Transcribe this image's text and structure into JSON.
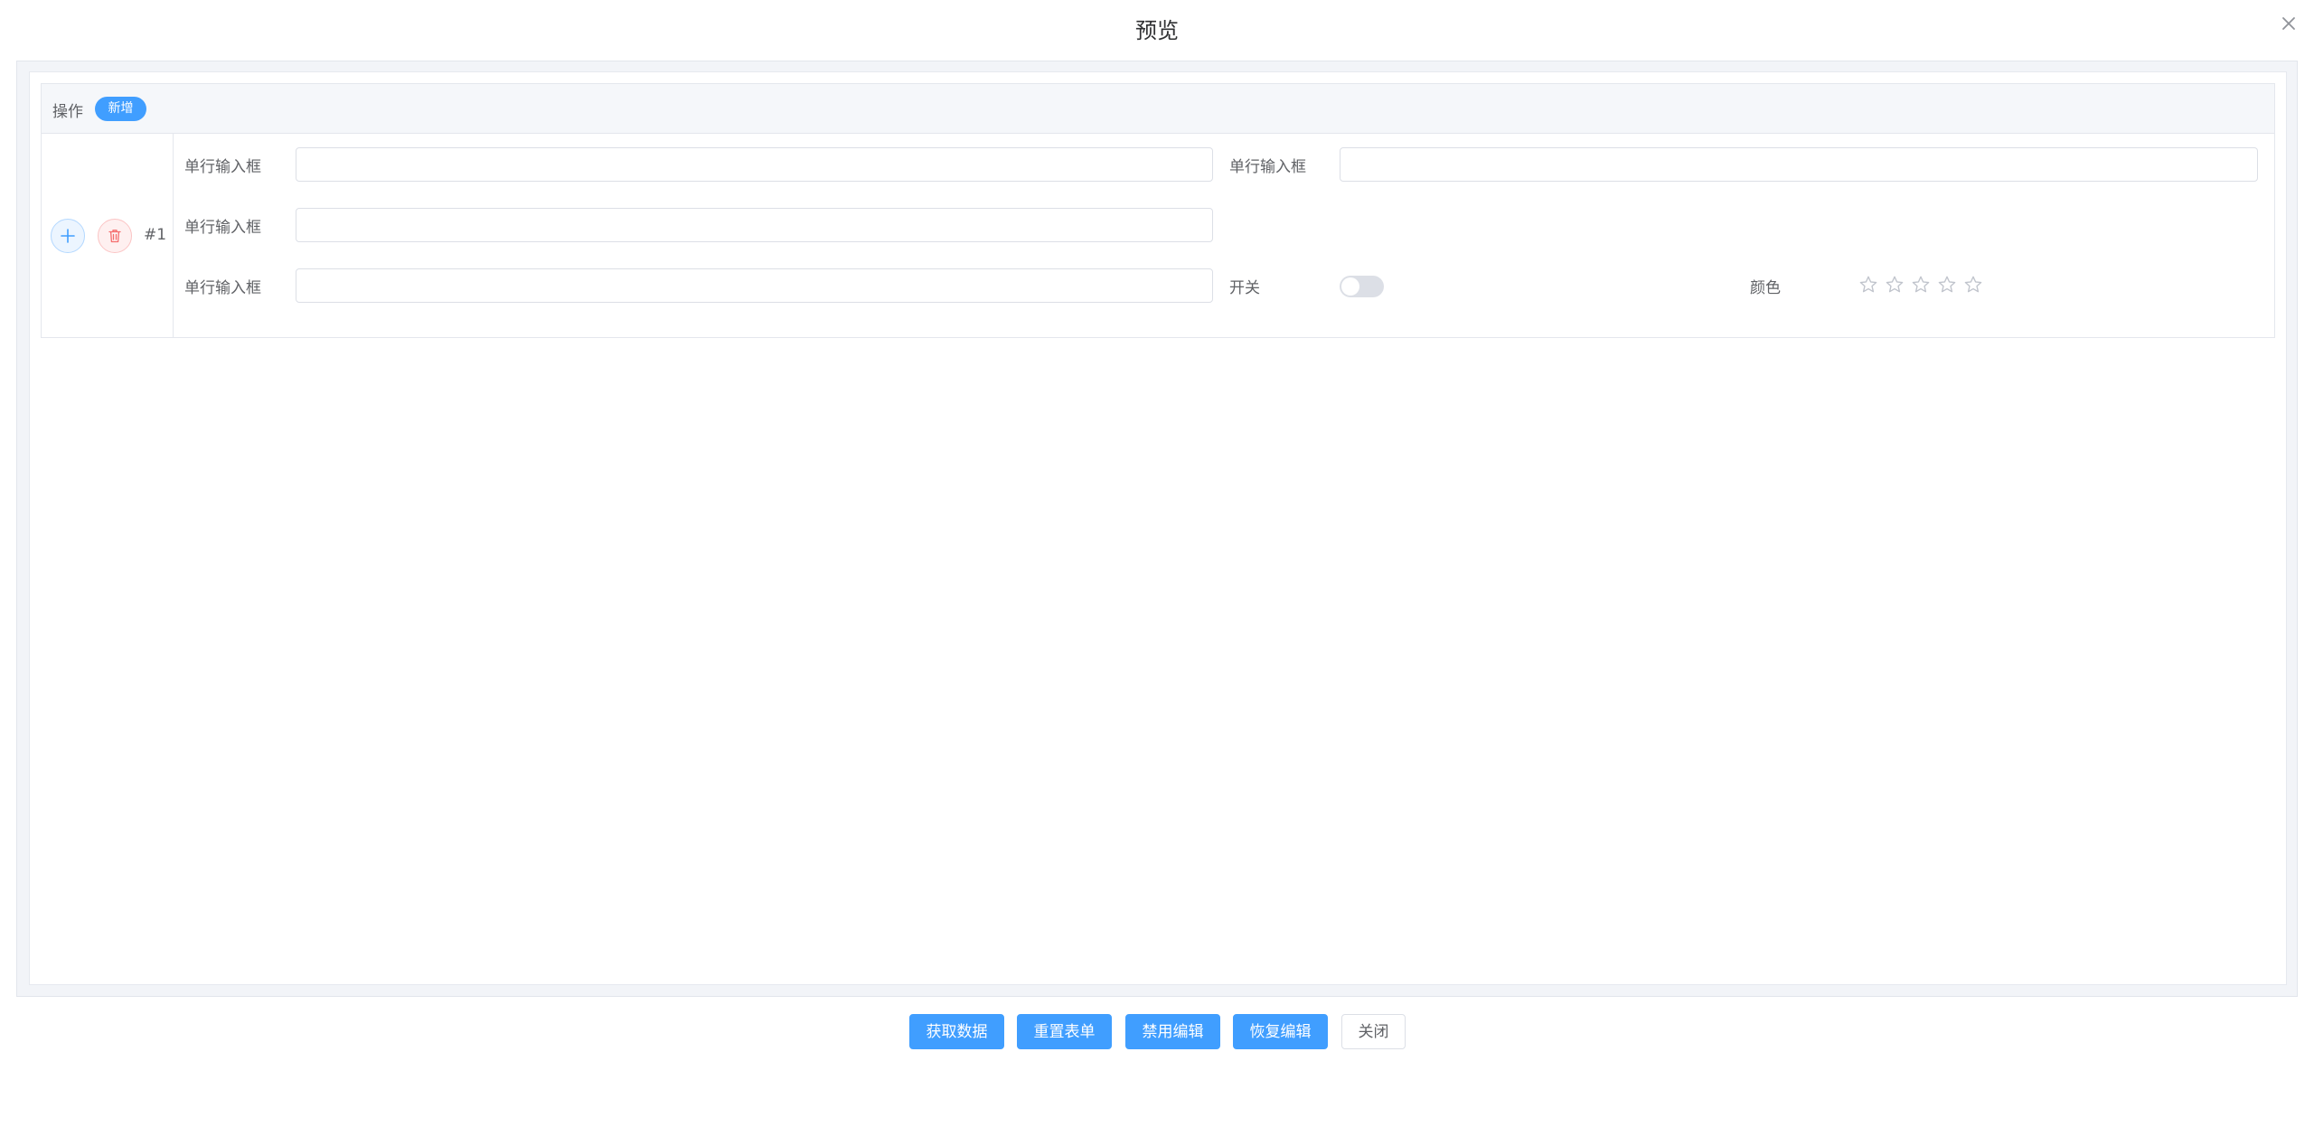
{
  "dialog": {
    "title": "预览",
    "close_icon": "close-icon"
  },
  "subform": {
    "ops_label": "操作",
    "add_new_label": "新增",
    "row": {
      "index_label": "#1",
      "add_icon": "plus-icon",
      "delete_icon": "trash-icon",
      "fields": {
        "input1_label": "单行输入框",
        "input1_value": "",
        "input2_label": "单行输入框",
        "input2_value": "",
        "input3_label": "单行输入框",
        "input3_value": "",
        "input4_label": "单行输入框",
        "input4_value": "",
        "switch_label": "开关",
        "switch_on": false,
        "rate_label": "颜色",
        "rate_value": 0,
        "rate_max": 5
      }
    }
  },
  "footer": {
    "get_data": "获取数据",
    "reset_form": "重置表单",
    "disable_edit": "禁用编辑",
    "restore_edit": "恢复编辑",
    "close": "关闭"
  },
  "colors": {
    "primary": "#409eff",
    "danger": "#f56c6c",
    "border": "#dcdfe6"
  }
}
